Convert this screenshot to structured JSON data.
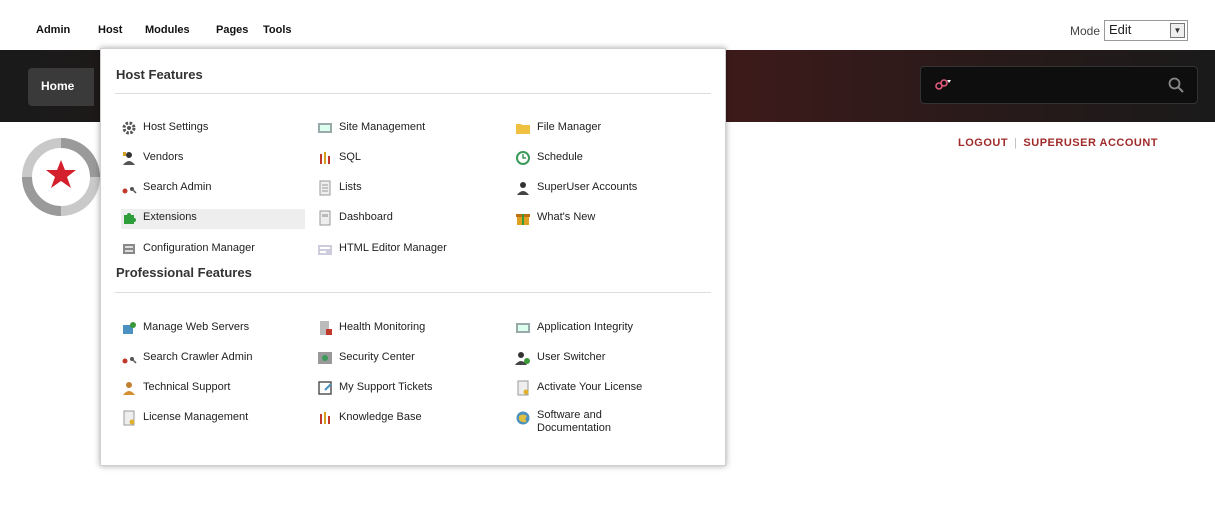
{
  "top_menu": {
    "items": [
      "Admin",
      "Host",
      "Modules",
      "Pages",
      "Tools"
    ],
    "mode_label": "Mode",
    "mode_value": "Edit"
  },
  "nav": {
    "home_label": "Home"
  },
  "user": {
    "logout": "LOGOUT",
    "account": "SUPERUSER ACCOUNT"
  },
  "host_menu": {
    "host_title": "Host Features",
    "host_items": [
      {
        "label": "Host Settings",
        "icon": "gear-icon"
      },
      {
        "label": "Site Management",
        "icon": "site-icon"
      },
      {
        "label": "File Manager",
        "icon": "folder-icon"
      },
      {
        "label": "Vendors",
        "icon": "vendor-icon"
      },
      {
        "label": "SQL",
        "icon": "sql-icon"
      },
      {
        "label": "Schedule",
        "icon": "schedule-icon"
      },
      {
        "label": "Search Admin",
        "icon": "search-admin-icon"
      },
      {
        "label": "Lists",
        "icon": "list-icon"
      },
      {
        "label": "SuperUser Accounts",
        "icon": "user-icon"
      },
      {
        "label": "Extensions",
        "icon": "puzzle-icon"
      },
      {
        "label": "Dashboard",
        "icon": "dashboard-icon"
      },
      {
        "label": "What's New",
        "icon": "gift-icon"
      },
      {
        "label": "Configuration Manager",
        "icon": "config-icon"
      },
      {
        "label": "HTML Editor Manager",
        "icon": "editor-icon"
      }
    ],
    "pro_title": "Professional Features",
    "pro_items": [
      {
        "label": "Manage Web Servers",
        "icon": "server-icon"
      },
      {
        "label": "Health Monitoring",
        "icon": "health-icon"
      },
      {
        "label": "Application Integrity",
        "icon": "integrity-icon"
      },
      {
        "label": "Search Crawler Admin",
        "icon": "crawler-icon"
      },
      {
        "label": "Security Center",
        "icon": "security-icon"
      },
      {
        "label": "User Switcher",
        "icon": "user-switch-icon"
      },
      {
        "label": "Technical Support",
        "icon": "support-icon"
      },
      {
        "label": "My Support Tickets",
        "icon": "ticket-icon"
      },
      {
        "label": "Activate Your License",
        "icon": "license-icon"
      },
      {
        "label": "License Management",
        "icon": "license-manage-icon"
      },
      {
        "label": "Knowledge Base",
        "icon": "knowledge-icon"
      },
      {
        "label": "Software and Documentation",
        "icon": "docs-icon"
      }
    ]
  }
}
